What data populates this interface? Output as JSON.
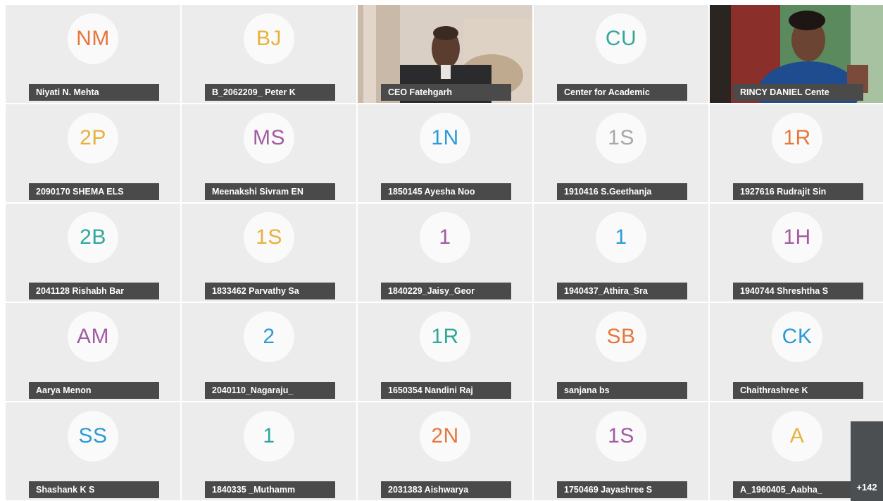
{
  "participants": [
    {
      "initials": "NM",
      "name": "Niyati N. Mehta",
      "color": "#e8763a"
    },
    {
      "initials": "BJ",
      "name": "B_2062209_ Peter K",
      "color": "#e8b13a"
    },
    {
      "initials": "",
      "name": "CEO Fatehgarh",
      "color": "#ffffff"
    },
    {
      "initials": "CU",
      "name": "Center for Academic",
      "color": "#2fa89a"
    },
    {
      "initials": "",
      "name": "RINCY DANIEL Cente",
      "color": "#ffffff"
    },
    {
      "initials": "2P",
      "name": "2090170 SHEMA ELS",
      "color": "#e8b13a"
    },
    {
      "initials": "MS",
      "name": "Meenakshi Sivram EN",
      "color": "#a25ba3"
    },
    {
      "initials": "1N",
      "name": "1850145 Ayesha Noo",
      "color": "#2d9ad6"
    },
    {
      "initials": "1S",
      "name": "1910416 S.Geethanja",
      "color": "#a8a8a8"
    },
    {
      "initials": "1R",
      "name": "1927616 Rudrajit Sin",
      "color": "#e8763a"
    },
    {
      "initials": "2B",
      "name": "2041128 Rishabh Bar",
      "color": "#2fa89a"
    },
    {
      "initials": "1S",
      "name": "1833462 Parvathy Sa",
      "color": "#e8b13a"
    },
    {
      "initials": "1",
      "name": "1840229_Jaisy_Geor",
      "color": "#a25ba3"
    },
    {
      "initials": "1",
      "name": "1940437_Athira_Sra",
      "color": "#2d9ad6"
    },
    {
      "initials": "1H",
      "name": "1940744 Shreshtha S",
      "color": "#a25ba3"
    },
    {
      "initials": "AM",
      "name": "Aarya Menon",
      "color": "#a25ba3"
    },
    {
      "initials": "2",
      "name": "2040110_Nagaraju_",
      "color": "#2d9ad6"
    },
    {
      "initials": "1R",
      "name": "1650354 Nandini Raj",
      "color": "#2fa89a"
    },
    {
      "initials": "SB",
      "name": "sanjana bs",
      "color": "#e8763a"
    },
    {
      "initials": "CK",
      "name": "Chaithrashree K",
      "color": "#2d9ad6"
    },
    {
      "initials": "SS",
      "name": "Shashank K S",
      "color": "#2d9ad6"
    },
    {
      "initials": "1",
      "name": "1840335 _Muthamm",
      "color": "#2fa89a"
    },
    {
      "initials": "2N",
      "name": "2031383 Aishwarya",
      "color": "#e8763a"
    },
    {
      "initials": "1S",
      "name": "1750469 Jayashree S",
      "color": "#a25ba3"
    },
    {
      "initials": "A",
      "name": "A_1960405_Aabha_",
      "color": "#e8b13a"
    }
  ],
  "more_count_label": "+142"
}
